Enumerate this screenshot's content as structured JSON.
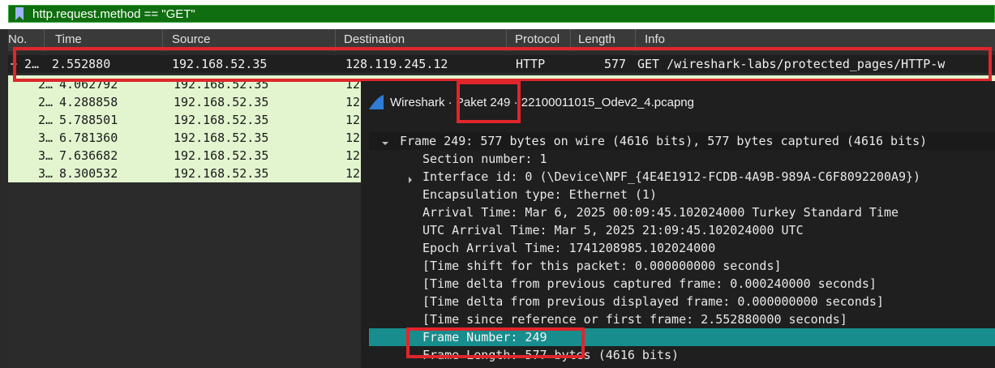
{
  "filter": {
    "value": "http.request.method == \"GET\""
  },
  "packet_list": {
    "columns": [
      "No.",
      "Time",
      "Source",
      "Destination",
      "Protocol",
      "Length",
      "Info"
    ],
    "rows": [
      {
        "no": "2…",
        "time": "2.552880",
        "source": "192.168.52.35",
        "destination": "128.119.245.12",
        "protocol": "HTTP",
        "length": "577",
        "info": "GET /wireshark-labs/protected_pages/HTTP-w",
        "selected": true
      },
      {
        "no": "2…",
        "time": "4.062792",
        "source": "192.168.52.35",
        "destination": "12",
        "protocol": "",
        "length": "",
        "info": ""
      },
      {
        "no": "2…",
        "time": "4.288858",
        "source": "192.168.52.35",
        "destination": "12",
        "protocol": "",
        "length": "",
        "info": ""
      },
      {
        "no": "2…",
        "time": "5.788501",
        "source": "192.168.52.35",
        "destination": "12",
        "protocol": "",
        "length": "",
        "info": ""
      },
      {
        "no": "3…",
        "time": "6.781360",
        "source": "192.168.52.35",
        "destination": "12",
        "protocol": "",
        "length": "",
        "info": ""
      },
      {
        "no": "3…",
        "time": "7.636682",
        "source": "192.168.52.35",
        "destination": "12",
        "protocol": "",
        "length": "",
        "info": ""
      },
      {
        "no": "3…",
        "time": "8.300532",
        "source": "192.168.52.35",
        "destination": "12",
        "protocol": "",
        "length": "",
        "info": ""
      }
    ]
  },
  "packet_window": {
    "title_prefix": "Wireshark · ",
    "title_packet": "Paket 249",
    "title_suffix": " · 22100011015_Odev2_4.pcapng",
    "lines": [
      {
        "text": "Frame 249: 577 bytes on wire (4616 bits), 577 bytes captured (4616 bits)",
        "arrow": "down"
      },
      {
        "text": "Section number: 1",
        "arrow": ""
      },
      {
        "text": "Interface id: 0 (\\Device\\NPF_{4E4E1912-FCDB-4A9B-989A-C6F8092200A9})",
        "arrow": "right"
      },
      {
        "text": "Encapsulation type: Ethernet (1)",
        "arrow": ""
      },
      {
        "text": "Arrival Time: Mar  6, 2025 00:09:45.102024000 Turkey Standard Time",
        "arrow": ""
      },
      {
        "text": "UTC Arrival Time: Mar  5, 2025 21:09:45.102024000 UTC",
        "arrow": ""
      },
      {
        "text": "Epoch Arrival Time: 1741208985.102024000",
        "arrow": ""
      },
      {
        "text": "[Time shift for this packet: 0.000000000 seconds]",
        "arrow": ""
      },
      {
        "text": "[Time delta from previous captured frame: 0.000240000 seconds]",
        "arrow": ""
      },
      {
        "text": "[Time delta from previous displayed frame: 0.000000000 seconds]",
        "arrow": ""
      },
      {
        "text": "[Time since reference or first frame: 2.552880000 seconds]",
        "arrow": ""
      },
      {
        "text": "Frame Number: 249",
        "arrow": "",
        "selected": true
      },
      {
        "text": "Frame Length: 577 bytes (4616 bits)",
        "arrow": ""
      }
    ]
  },
  "colors": {
    "filter_bg": "#0f6e0f",
    "highlight_red": "#e0262b",
    "row_green": "#e2f5cf",
    "selected_teal": "#188d8d"
  },
  "icons": {
    "filter": "bookmark-icon",
    "app": "wireshark-fin-icon"
  }
}
